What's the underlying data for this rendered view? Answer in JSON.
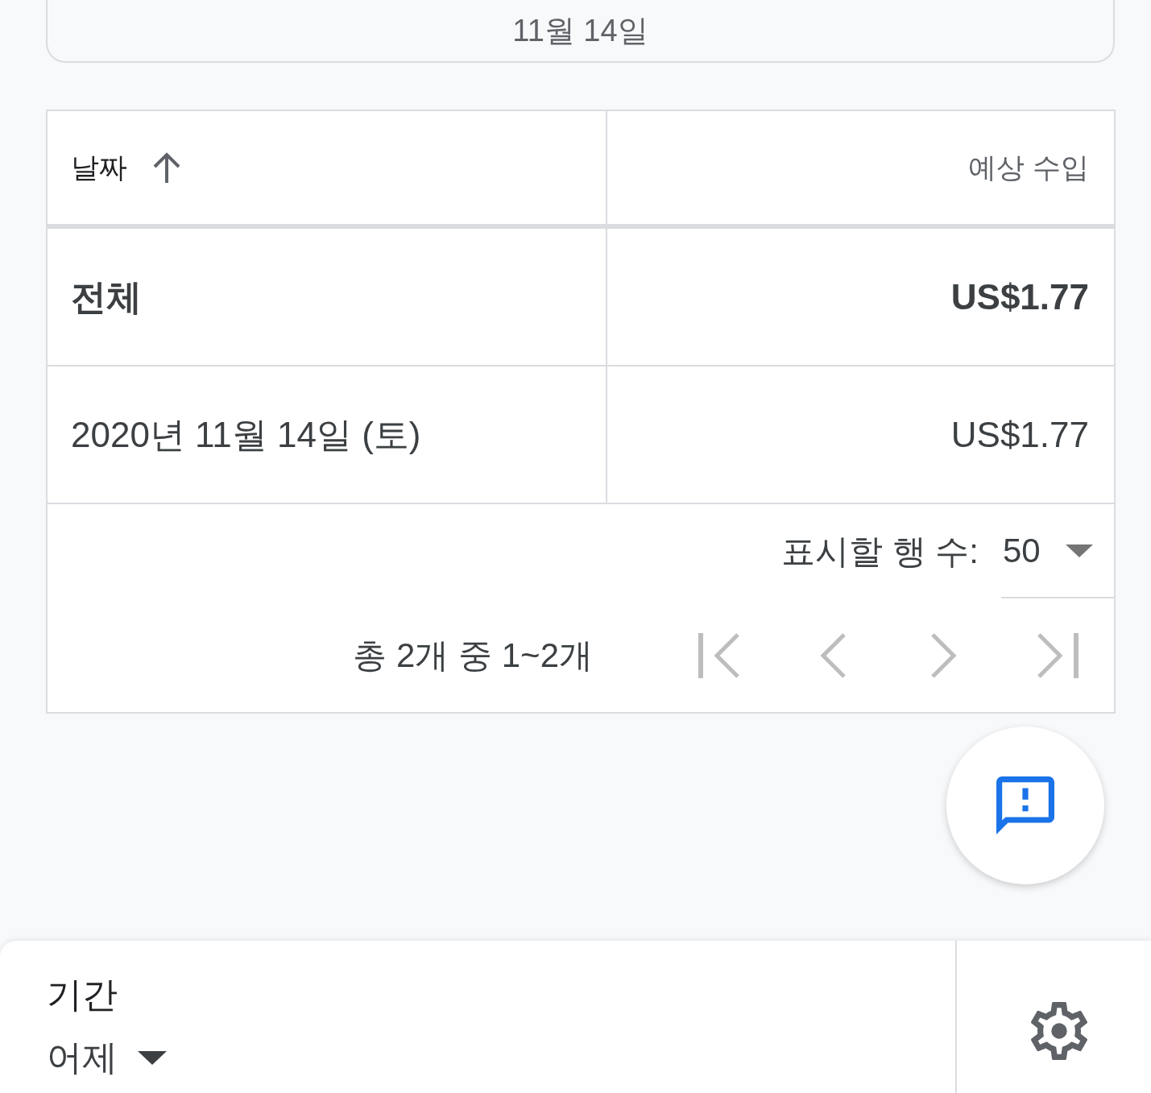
{
  "date_card": {
    "label": "11월 14일"
  },
  "table": {
    "columns": [
      {
        "label": "날짜",
        "sorted": true
      },
      {
        "label": "예상 수입",
        "sorted": false
      }
    ],
    "total_row": {
      "label": "전체",
      "value": "US$1.77"
    },
    "rows": [
      {
        "date": "2020년 11월 14일 (토)",
        "value": "US$1.77"
      }
    ],
    "pagination": {
      "rows_per_page_label": "표시할 행 수:",
      "rows_per_page": "50",
      "range": "총 2개 중 1~2개",
      "buttons": [
        {
          "kind": "first",
          "disabled": true
        },
        {
          "kind": "previous",
          "disabled": true
        },
        {
          "kind": "next",
          "disabled": true
        },
        {
          "kind": "last",
          "disabled": true
        }
      ]
    }
  },
  "bottom_bar": {
    "filter_label": "기간",
    "filter_value": "어제"
  }
}
